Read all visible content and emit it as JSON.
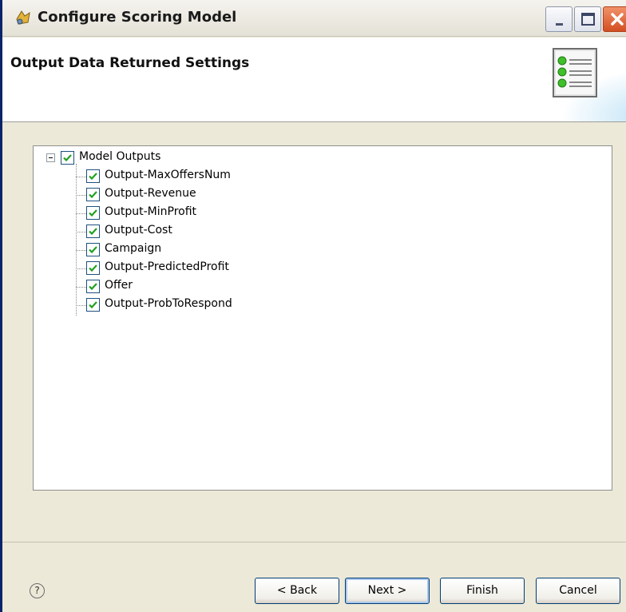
{
  "window": {
    "title": "Configure Scoring Model",
    "icon": "scoring-model-icon"
  },
  "header": {
    "title": "Output Data Returned Settings",
    "icon": "list-settings-icon"
  },
  "tree": {
    "root": {
      "label": "Model Outputs",
      "checked": true,
      "expanded": true
    },
    "items": [
      {
        "label": "Output-MaxOffersNum",
        "checked": true
      },
      {
        "label": "Output-Revenue",
        "checked": true
      },
      {
        "label": "Output-MinProfit",
        "checked": true
      },
      {
        "label": "Output-Cost",
        "checked": true
      },
      {
        "label": "Campaign",
        "checked": true
      },
      {
        "label": "Output-PredictedProfit",
        "checked": true
      },
      {
        "label": "Offer",
        "checked": true
      },
      {
        "label": "Output-ProbToRespond",
        "checked": true
      }
    ]
  },
  "footer": {
    "help": "?",
    "back_label": "< Back",
    "next_label": "Next >",
    "finish_label": "Finish",
    "cancel_label": "Cancel"
  },
  "colors": {
    "accent": "#0a246a",
    "check": "#21a121",
    "window_bg": "#ece9d8"
  }
}
